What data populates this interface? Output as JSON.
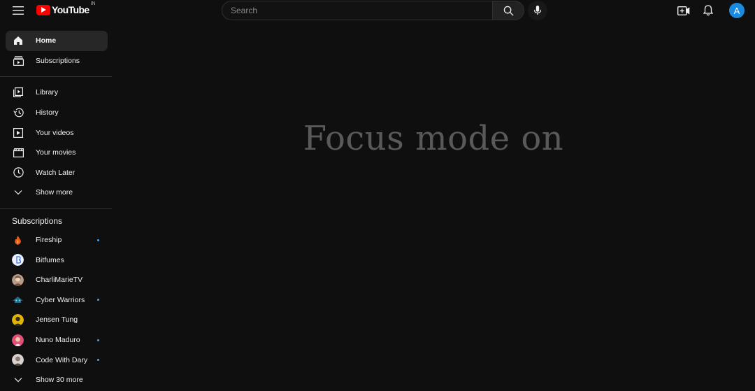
{
  "header": {
    "logo_text": "YouTube",
    "region": "IN",
    "search_placeholder": "Search",
    "avatar_letter": "A"
  },
  "sidebar": {
    "main": [
      {
        "label": "Home",
        "icon": "home-icon",
        "active": true
      },
      {
        "label": "Subscriptions",
        "icon": "subscriptions-icon"
      }
    ],
    "library": [
      {
        "label": "Library",
        "icon": "library-icon"
      },
      {
        "label": "History",
        "icon": "history-icon"
      },
      {
        "label": "Your videos",
        "icon": "your-videos-icon"
      },
      {
        "label": "Your movies",
        "icon": "movies-icon"
      },
      {
        "label": "Watch Later",
        "icon": "watch-later-icon"
      },
      {
        "label": "Show more",
        "icon": "chevron-down-icon"
      }
    ],
    "subscriptions_title": "Subscriptions",
    "subscriptions": [
      {
        "label": "Fireship",
        "new": true,
        "color": "#e65c1a"
      },
      {
        "label": "Bitfumes",
        "new": false,
        "color": "#3a6fd8"
      },
      {
        "label": "CharliMarieTV",
        "new": false,
        "color": "#b89b87"
      },
      {
        "label": "Cyber Warriors",
        "new": true,
        "color": "#1b6f8a"
      },
      {
        "label": "Jensen Tung",
        "new": false,
        "color": "#e0b400"
      },
      {
        "label": "Nuno Maduro",
        "new": true,
        "color": "#e2507a"
      },
      {
        "label": "Code With Dary",
        "new": true,
        "color": "#8a7a70"
      }
    ],
    "show_more_subs": "Show 30 more"
  },
  "main": {
    "focus_text": "Focus mode on"
  },
  "colors": {
    "background": "#0f0f0f",
    "brand_red": "#ff0000",
    "new_dot": "#3ea6ff",
    "avatar_bg": "#1a8ae0"
  }
}
